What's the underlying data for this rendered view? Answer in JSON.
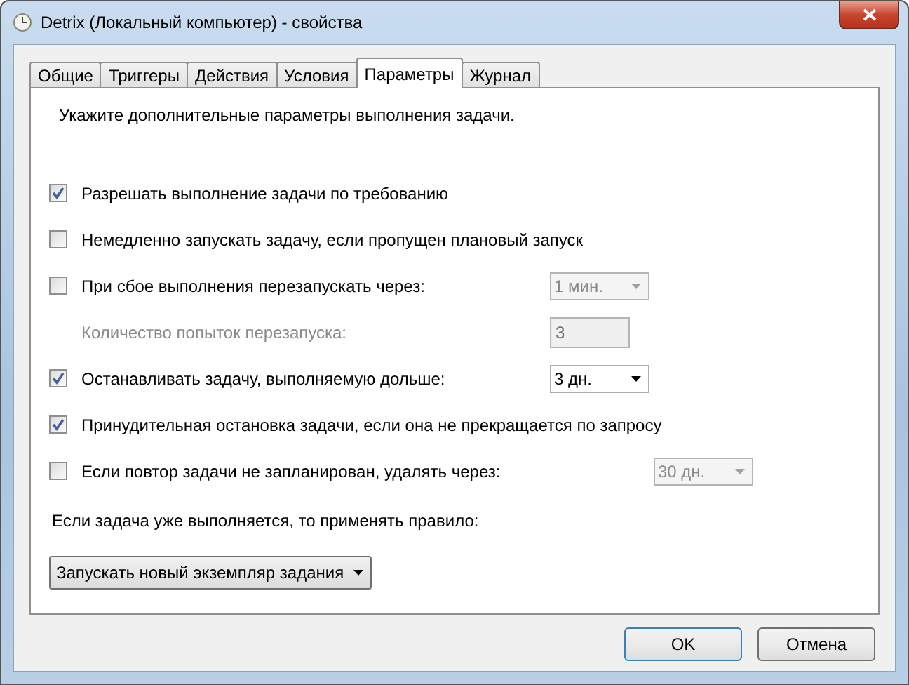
{
  "window": {
    "title": "Detrix (Локальный компьютер) - свойства"
  },
  "tabs": [
    {
      "label": "Общие",
      "selected": false
    },
    {
      "label": "Триггеры",
      "selected": false
    },
    {
      "label": "Действия",
      "selected": false
    },
    {
      "label": "Условия",
      "selected": false
    },
    {
      "label": "Параметры",
      "selected": true
    },
    {
      "label": "Журнал",
      "selected": false
    }
  ],
  "intro": "Укажите дополнительные параметры выполнения задачи.",
  "options": [
    {
      "kind": "checkbox",
      "label": "Разрешать выполнение задачи по требованию",
      "checked": true
    },
    {
      "kind": "checkbox",
      "label": "Немедленно запускать задачу, если пропущен плановый запуск",
      "checked": false
    },
    {
      "kind": "checkbox",
      "label": "При сбое выполнения перезапускать через:",
      "checked": false,
      "control": {
        "kind": "dropdown",
        "value": "1 мин.",
        "disabled": true
      }
    },
    {
      "kind": "label",
      "label": "Количество попыток перезапуска:",
      "disabled": true,
      "control": {
        "kind": "number",
        "value": "3",
        "disabled": true
      }
    },
    {
      "kind": "checkbox",
      "label": "Останавливать задачу, выполняемую дольше:",
      "checked": true,
      "control": {
        "kind": "dropdown",
        "value": "3 дн.",
        "disabled": false
      }
    },
    {
      "kind": "checkbox",
      "label": "Принудительная остановка задачи, если она не прекращается по запросу",
      "checked": true
    },
    {
      "kind": "checkbox",
      "label": "Если повтор задачи не запланирован, удалять через:",
      "checked": false,
      "control": {
        "kind": "dropdown",
        "value": "30 дн.",
        "disabled": true
      }
    }
  ],
  "rule_label": "Если задача уже выполняется, то применять правило:",
  "rule_select": {
    "value": "Запускать новый экземпляр задания"
  },
  "buttons": [
    "OK",
    "Отмена"
  ]
}
